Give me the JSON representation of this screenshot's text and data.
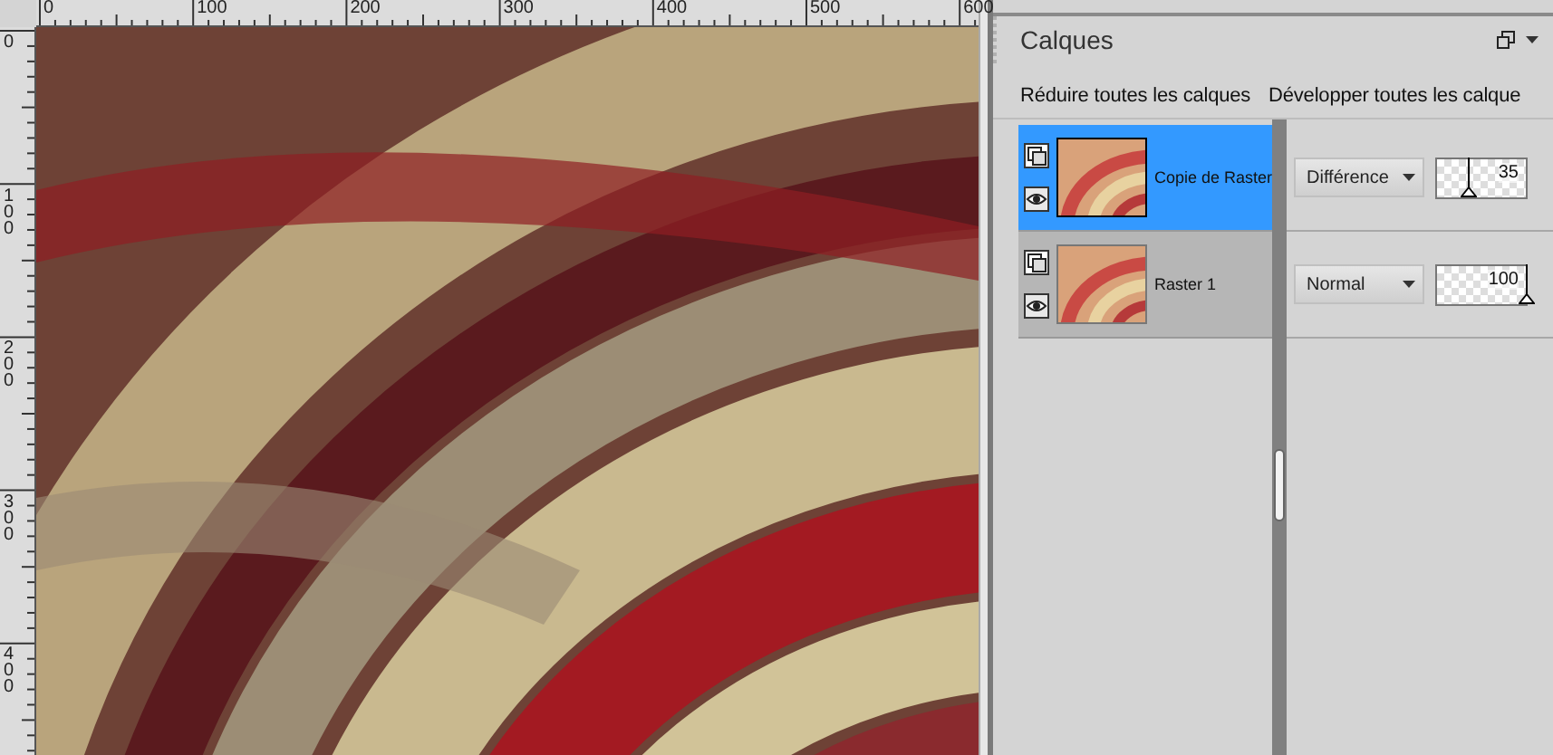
{
  "canvas": {
    "kind": "picture",
    "top_ruler": [
      "0",
      "100",
      "200",
      "300",
      "400",
      "500",
      "600"
    ],
    "left_ruler": [
      "0",
      "100",
      "200",
      "300",
      "400"
    ]
  },
  "layers_panel": {
    "title": "Calques",
    "actions": [
      "Réduire toutes les calques",
      "Développer toutes les calque"
    ],
    "layers": [
      {
        "name": "Copie de Raster",
        "selected": true,
        "blend_mode": "Différence",
        "opacity": "35",
        "level": 0.35
      },
      {
        "name": "Raster 1",
        "selected": false,
        "blend_mode": "Normal",
        "opacity": "100",
        "level": 1
      }
    ]
  }
}
